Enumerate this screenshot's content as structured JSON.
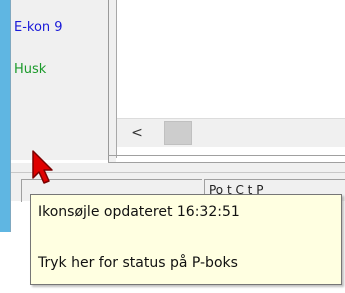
{
  "colors": {
    "strip_blue": "#5fb6e2",
    "nav_blue": "#1a1ad8",
    "nav_green": "#1a9a2a",
    "tooltip_bg": "#ffffe1",
    "cursor_red": "#e00000"
  },
  "sidebar": {
    "items": [
      {
        "label": "E-kon 9"
      },
      {
        "label": "Husk"
      }
    ]
  },
  "scrollbar": {
    "left_arrow": "<"
  },
  "statusbar": {
    "cell_2_text": "Po t  C  t  P"
  },
  "tooltip": {
    "line_1": "Ikonsøjle opdateret 16:32:51",
    "line_2": "Tryk her for status på P-boks"
  },
  "icons": {
    "cursor": "arrow-cursor-icon"
  }
}
